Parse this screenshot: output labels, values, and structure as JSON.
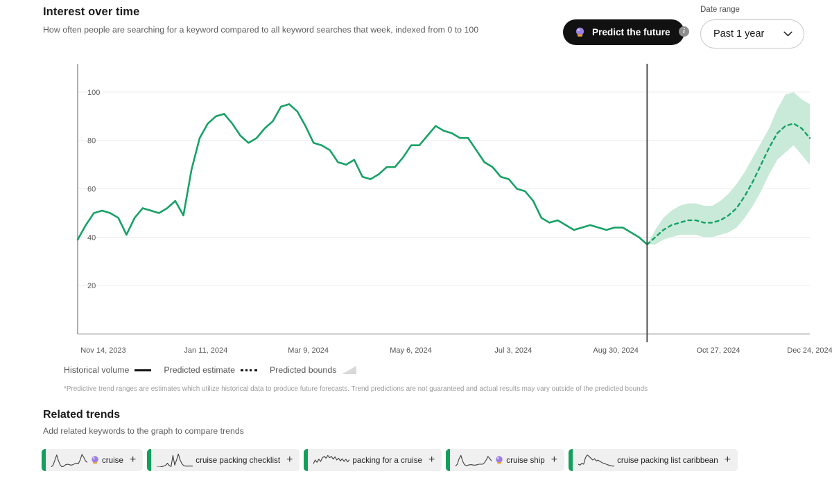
{
  "header": {
    "title": "Interest over time",
    "subtitle": "How often people are searching for a keyword compared to all keyword searches that week, indexed from 0 to 100",
    "predict_button_label": "Predict the future",
    "predict_icon": "crystal-ball-icon",
    "info_icon": "info-icon",
    "info_glyph": "i",
    "date_range_label": "Date range",
    "date_range_value": "Past 1 year",
    "date_range_options": [
      "Past 1 year"
    ],
    "chevron_icon": "chevron-down-icon"
  },
  "legend": {
    "historical": "Historical volume",
    "predicted_estimate": "Predicted estimate",
    "predicted_bounds": "Predicted bounds"
  },
  "footnote": "*Predictive trend ranges are estimates which utilize historical data to produce future forecasts. Trend predictions are not guaranteed and actual results may vary outside of the predicted bounds",
  "related": {
    "title": "Related trends",
    "subtitle": "Add related keywords to the graph to compare trends",
    "add_icon": "plus-icon",
    "chips": [
      {
        "label": "cruise",
        "has_ball": true,
        "spark": [
          60,
          52,
          30,
          8,
          34,
          52,
          60,
          56,
          50,
          48,
          50,
          52,
          50,
          46,
          44,
          46,
          30,
          6,
          18,
          34,
          40
        ]
      },
      {
        "label": "cruise packing checklist",
        "has_ball": false,
        "spark": [
          60,
          60,
          60,
          58,
          56,
          52,
          44,
          54,
          58,
          10,
          52,
          30,
          4,
          30,
          46,
          54,
          56,
          56,
          56,
          56,
          56
        ]
      },
      {
        "label": "packing for a cruise",
        "has_ball": false,
        "spark": [
          46,
          30,
          40,
          26,
          36,
          20,
          14,
          22,
          10,
          20,
          14,
          26,
          16,
          30,
          22,
          34,
          24,
          36,
          26,
          38,
          28
        ]
      },
      {
        "label": "cruise ship",
        "has_ball": true,
        "spark": [
          56,
          48,
          24,
          10,
          36,
          50,
          54,
          52,
          50,
          50,
          52,
          52,
          50,
          48,
          48,
          48,
          42,
          30,
          14,
          24,
          34
        ]
      },
      {
        "label": "cruise packing list caribbean",
        "has_ball": false,
        "spark": [
          48,
          52,
          44,
          48,
          20,
          8,
          14,
          22,
          30,
          24,
          34,
          30,
          36,
          40,
          44,
          46,
          50,
          52,
          54,
          56,
          56
        ]
      }
    ]
  },
  "chart_data": {
    "type": "line",
    "title": "Interest over time",
    "xlabel": "",
    "ylabel": "",
    "ylim": [
      0,
      110
    ],
    "yticks": [
      20,
      40,
      60,
      80,
      100
    ],
    "grid": true,
    "legend_position": "below",
    "xticks": [
      "Nov 14, 2023",
      "Jan 11, 2024",
      "Mar 9, 2024",
      "May 6, 2024",
      "Jul 3, 2024",
      "Aug 30, 2024",
      "Oct 27, 2024",
      "Dec 24, 2024"
    ],
    "xtick_positions": [
      0.035,
      0.175,
      0.315,
      0.455,
      0.595,
      0.735,
      0.875,
      1.0
    ],
    "divider_label": "Oct 27, 2024",
    "divider_position": 0.875,
    "colors": {
      "historical_line": "#17a166",
      "predicted_line": "#17a166",
      "band_fill": "#c9ead9",
      "divider": "#444444",
      "grid": "#ededed",
      "axis": "#9a9a9a"
    },
    "series": [
      {
        "name": "Historical volume",
        "style": "solid",
        "values": [
          39,
          45,
          50,
          51,
          50,
          48,
          41,
          48,
          52,
          51,
          50,
          52,
          55,
          49,
          68,
          81,
          87,
          90,
          91,
          87,
          82,
          79,
          81,
          85,
          88,
          94,
          95,
          92,
          86,
          79,
          78,
          76,
          71,
          70,
          72,
          65,
          64,
          66,
          69,
          69,
          73,
          78,
          78,
          82,
          86,
          84,
          83,
          81,
          81,
          76,
          71,
          69,
          65,
          64,
          60,
          59,
          55,
          48,
          46,
          47,
          45,
          43,
          44,
          45,
          44,
          43,
          44,
          44,
          42,
          40,
          37
        ]
      },
      {
        "name": "Predicted estimate",
        "style": "dashed",
        "values": [
          37,
          40,
          43,
          45,
          46,
          47,
          47,
          46,
          46,
          47,
          49,
          52,
          57,
          63,
          70,
          77,
          83,
          86,
          87,
          85,
          81
        ],
        "bounds_upper": [
          37,
          43,
          48,
          51,
          53,
          54,
          54,
          53,
          53,
          55,
          58,
          62,
          67,
          73,
          79,
          85,
          93,
          99,
          100,
          97,
          95
        ],
        "bounds_lower": [
          37,
          37,
          39,
          40,
          41,
          41,
          41,
          40,
          40,
          41,
          42,
          44,
          48,
          53,
          59,
          66,
          72,
          75,
          78,
          74,
          70
        ]
      }
    ]
  }
}
